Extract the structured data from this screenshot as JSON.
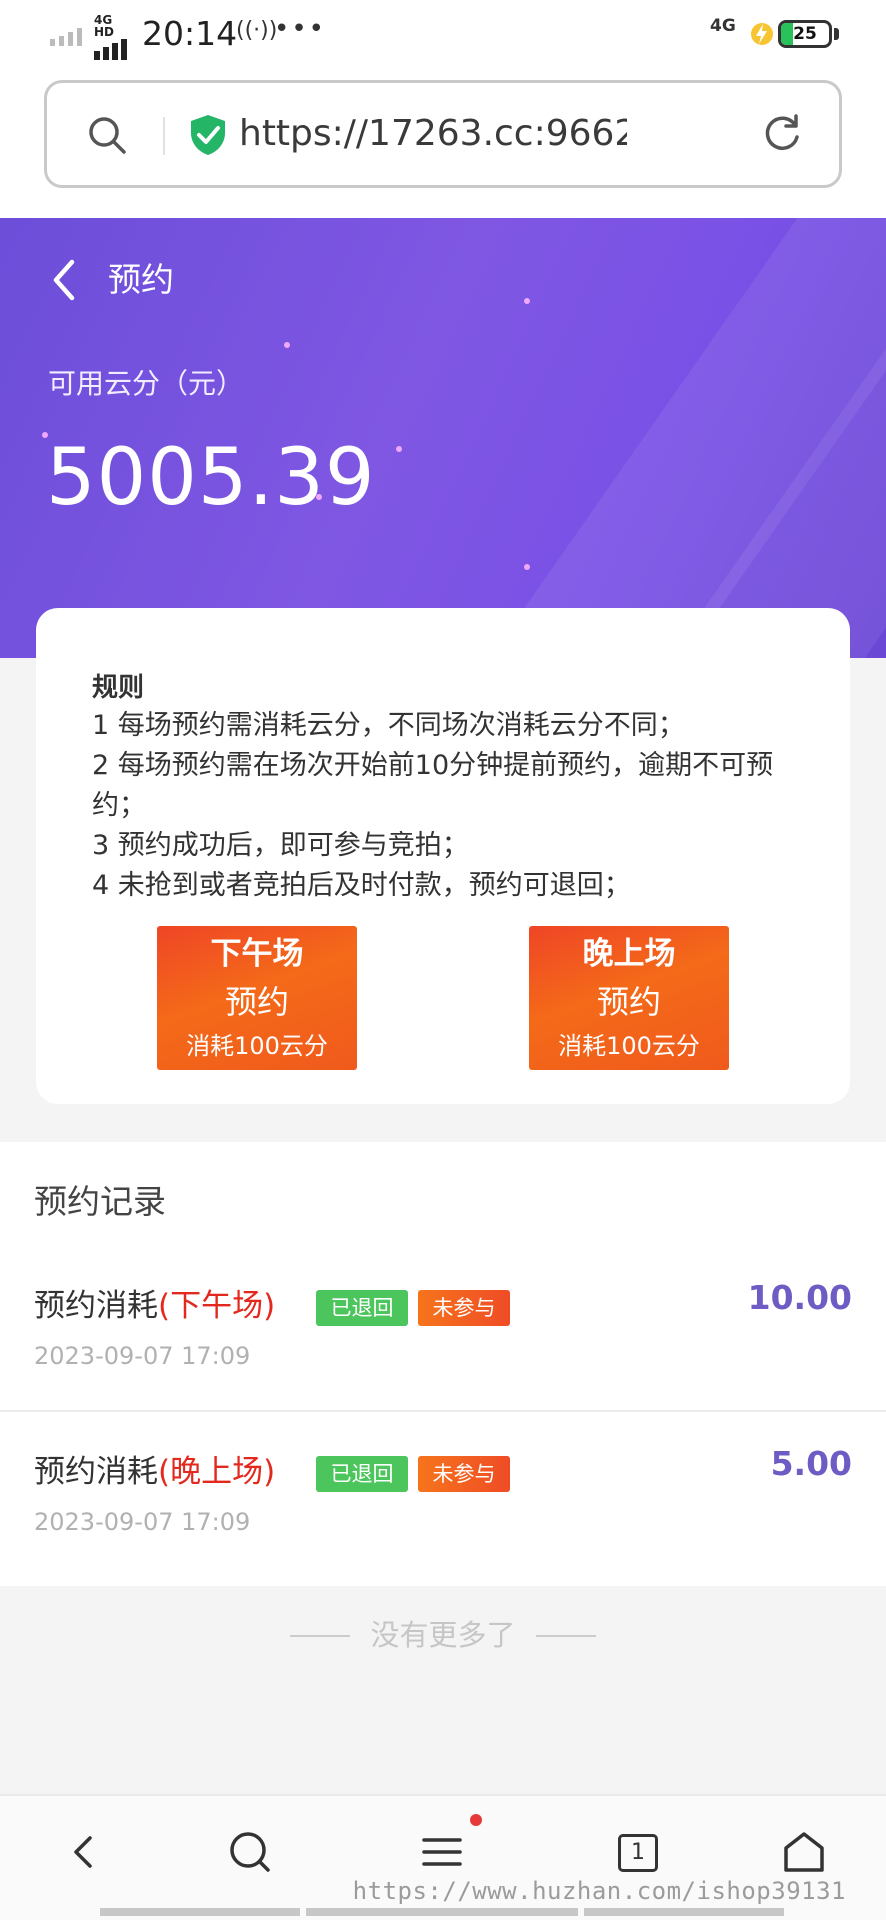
{
  "status_bar": {
    "network_label": "4G HD",
    "time": "20:14",
    "extra_icon": "hotspot-icon",
    "right_network": "4G",
    "battery": "25"
  },
  "browser": {
    "url": "https://17263.cc:9662/h5/···",
    "search_icon": "search-icon",
    "secure_icon": "shield-check-icon",
    "reload_icon": "reload-icon"
  },
  "header": {
    "title": "预约",
    "balance_label": "可用云分（元）",
    "balance": "5005.39"
  },
  "rules": {
    "title": "规则",
    "lines": [
      "1 每场预约需消耗云分，不同场次消耗云分不同；",
      "2 每场预约需在场次开始前10分钟提前预约，逾期不可预",
      "约；",
      "3 预约成功后，即可参与竞拍；",
      "4 未抢到或者竞拍后及时付款，预约可退回；"
    ],
    "sessions": [
      {
        "name": "下午场",
        "action": "预约",
        "cost": "消耗100云分"
      },
      {
        "name": "晚上场",
        "action": "预约",
        "cost": "消耗100云分"
      }
    ]
  },
  "records": {
    "title": "预约记录",
    "items": [
      {
        "prefix": "预约消耗",
        "session": "(下午场)",
        "badge_returned": "已退回",
        "badge_absent": "未参与",
        "time": "2023-09-07 17:09",
        "amount": "10.00"
      },
      {
        "prefix": "预约消耗",
        "session": "(晚上场)",
        "badge_returned": "已退回",
        "badge_absent": "未参与",
        "time": "2023-09-07 17:09",
        "amount": "5.00"
      }
    ],
    "end_text": "没有更多了"
  },
  "bottom_nav": {
    "tab_count": "1",
    "icons": [
      "back-icon",
      "search-icon",
      "menu-icon",
      "tabs-icon",
      "home-icon"
    ]
  },
  "watermark": "https://www.huzhan.com/ishop39131",
  "colors": {
    "accent_purple": "#7b55e2",
    "session_red": "#e3281d",
    "amount_purple": "#6e5cc4",
    "badge_green": "#4dc55d",
    "badge_orange": "#f46a1c"
  }
}
